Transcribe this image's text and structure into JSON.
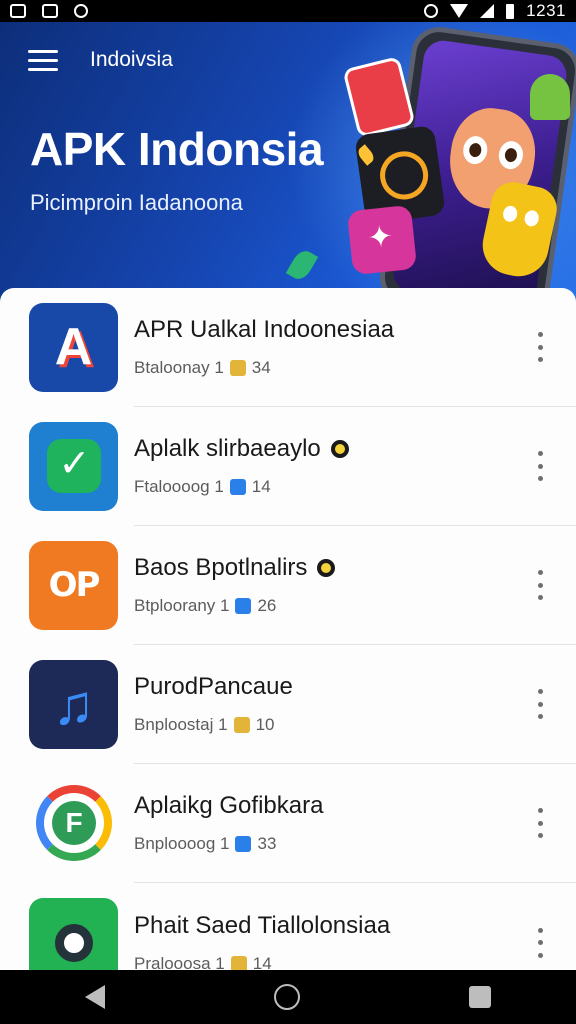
{
  "status_bar": {
    "time": "1231",
    "icons": [
      "image-icon",
      "message-icon",
      "sync-icon",
      "alarm-icon",
      "wifi-icon",
      "signal-icon",
      "battery-icon"
    ]
  },
  "header": {
    "app_title": "Indoivsia",
    "hero_title": "APK Indonsia",
    "hero_subtitle": "Picimproin Iadanoona",
    "colors": {
      "gradient_start": "#0d2e7a",
      "gradient_end": "#2a74e8"
    }
  },
  "apps": [
    {
      "name": "APR Ualkal Indoonesiaa",
      "meta_prefix": "Btaloonay 1",
      "meta_count": "34",
      "badge": "gold",
      "icon": "a-logo-icon",
      "has_dot": false
    },
    {
      "name": "Aplalk slirbaeaylo",
      "meta_prefix": "Ftaloooog 1",
      "meta_count": "14",
      "badge": "blue",
      "icon": "check-shield-icon",
      "has_dot": true
    },
    {
      "name": "Baos Bpotlnalirs",
      "meta_prefix": "Btploorany 1",
      "meta_count": "26",
      "badge": "blue",
      "icon": "op-logo-icon",
      "has_dot": true
    },
    {
      "name": "PurodPancaue",
      "meta_prefix": "Bnploostaj 1",
      "meta_count": "10",
      "badge": "gold",
      "icon": "music-note-icon",
      "has_dot": false
    },
    {
      "name": "Aplaikg Gofibkara",
      "meta_prefix": "Bnploooog 1",
      "meta_count": "33",
      "badge": "blue",
      "icon": "f-ring-icon",
      "has_dot": false
    },
    {
      "name": "Phait Saed Tiallolonsiaa",
      "meta_prefix": "Pralooosa 1",
      "meta_count": "14",
      "badge": "gold",
      "icon": "gear-eye-icon",
      "has_dot": false
    }
  ],
  "nav": {
    "back": "back-icon",
    "home": "home-icon",
    "recents": "recents-icon"
  }
}
